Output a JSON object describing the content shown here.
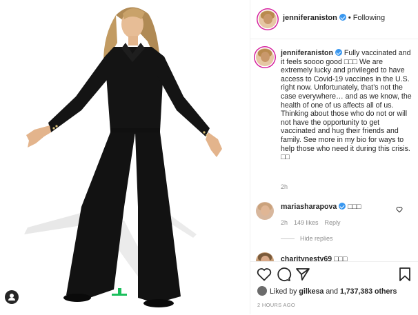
{
  "post": {
    "username": "jenniferaniston",
    "follow_state": "Following",
    "caption_text": "Fully vaccinated and it feels soooo good □□□ We are extremely lucky and privileged to have access to Covid-19 vaccines in the U.S. right now. Unfortunately, that’s not the case everywhere… and as we know, the health of one of us affects all of us. Thinking about those who do not or will not have the opportunity to get vaccinated and hug their friends and family. See more in my bio for ways to help those who need it during this crisis. □□",
    "caption_time": "2h",
    "comments": [
      {
        "username": "mariasharapova",
        "text": "□□□",
        "time": "2h",
        "likes": "149 likes",
        "reply": "Reply",
        "hide_replies": "Hide replies"
      },
      {
        "username": "charitynesty69 □□□"
      }
    ],
    "likes": {
      "prefix": "Liked by",
      "liker": "gilkesa",
      "joiner": "and",
      "count": "1,737,383 others"
    },
    "posted_time": "2 HOURS AGO"
  },
  "icons": {
    "verified": "verified-badge-icon",
    "heart": "heart-icon",
    "comment": "comment-icon",
    "share": "share-icon",
    "save": "bookmark-icon",
    "user_tag": "user-tag-icon"
  },
  "colors": {
    "verified": "#3897f0",
    "text": "#262626",
    "muted": "#8e8e8e",
    "border": "#efefef"
  }
}
